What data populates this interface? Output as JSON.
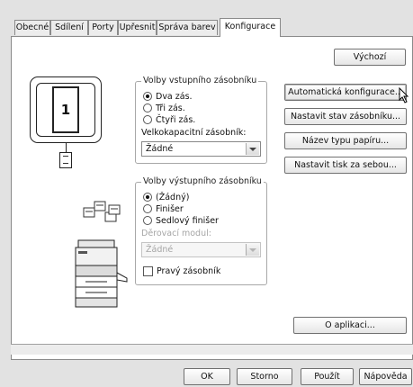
{
  "tabs": [
    "Obecné",
    "Sdílení",
    "Porty",
    "Upřesnit",
    "Správa barev",
    "Konfigurace"
  ],
  "active_tab": "Konfigurace",
  "preview": {
    "tray_number": "1"
  },
  "input_tray_group": {
    "legend": "Volby vstupního zásobníku",
    "options": [
      "Dva zás.",
      "Tři zás.",
      "Čtyři zás."
    ],
    "selected": "Dva zás.",
    "large_capacity_label": "Velkokapacitní zásobník:",
    "large_capacity_value": "Žádné"
  },
  "output_tray_group": {
    "legend": "Volby výstupního zásobníku",
    "options": [
      "(Žádný)",
      "Finišer",
      "Sedlový finišer"
    ],
    "selected": "(Žádný)",
    "punch_label": "Děrovací modul:",
    "punch_value": "Žádné",
    "right_tray_label": "Pravý zásobník",
    "right_tray_checked": false
  },
  "buttons": {
    "default": "Výchozí",
    "auto_config": "Automatická konfigurace...",
    "tray_status": "Nastavit stav zásobníku...",
    "paper_type": "Název typu papíru...",
    "print_setup": "Nastavit tisk za sebou...",
    "about": "O aplikaci..."
  },
  "footer": {
    "ok": "OK",
    "cancel": "Storno",
    "apply": "Použít",
    "help": "Nápověda"
  },
  "colors": {
    "dialog_bg": "#e2e2e2",
    "panel_bg": "#ffffff",
    "border": "#8a8a8a"
  }
}
